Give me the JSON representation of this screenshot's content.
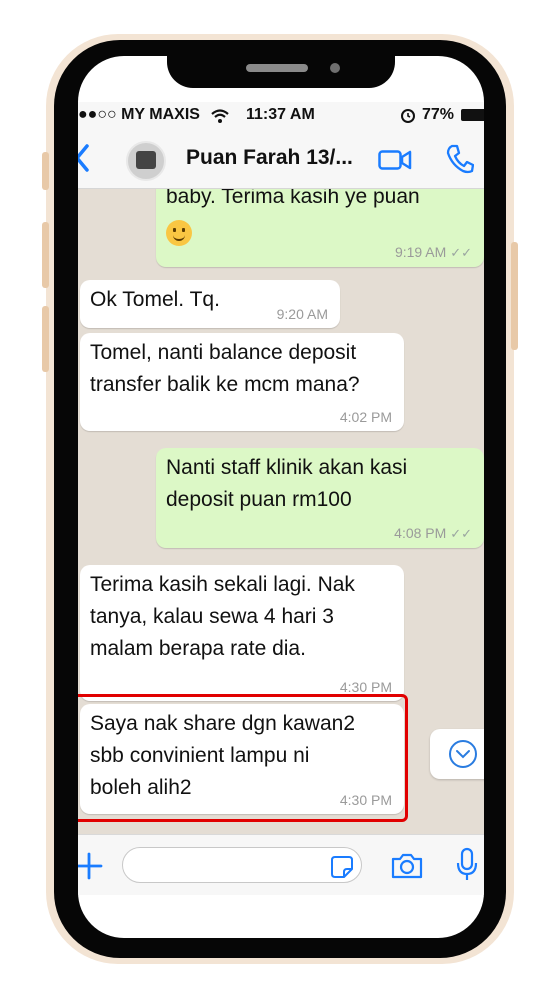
{
  "status_bar": {
    "carrier": "●●○○ MY MAXIS",
    "time": "11:37 AM",
    "battery": "77%"
  },
  "header": {
    "contact_name": "Puan Farah 13/..."
  },
  "messages": [
    {
      "direction": "outgoing",
      "lines": [
        "baby. Terima kasih ye puan"
      ],
      "emoji": "smiling-face",
      "time": "9:19 AM",
      "read": true
    },
    {
      "direction": "incoming",
      "lines": [
        "Ok Tomel. Tq."
      ],
      "time": "9:20 AM"
    },
    {
      "direction": "incoming",
      "lines": [
        "Tomel, nanti balance deposit",
        "transfer balik ke mcm mana?"
      ],
      "time": "4:02 PM"
    },
    {
      "direction": "outgoing",
      "lines": [
        "Nanti staff klinik akan kasi",
        "deposit puan rm100"
      ],
      "time": "4:08 PM",
      "read": true
    },
    {
      "direction": "incoming",
      "lines": [
        "Terima kasih sekali lagi. Nak",
        "tanya, kalau sewa 4 hari 3",
        "malam berapa rate dia."
      ],
      "time": "4:30 PM"
    },
    {
      "direction": "incoming",
      "lines": [
        "Saya nak share dgn kawan2",
        "sbb convinient lampu ni",
        "boleh alih2"
      ],
      "time": "4:30 PM",
      "highlighted": true
    }
  ],
  "ticks_glyph": "✓✓",
  "colors": {
    "outgoing_bubble": "#dcf8c6",
    "incoming_bubble": "#ffffff",
    "chat_background": "#e4ddd4",
    "accent_blue": "#1a7cff",
    "highlight_red": "#e10000"
  },
  "icons": [
    "back-chevron-icon",
    "video-call-icon",
    "phone-call-icon",
    "scroll-down-icon",
    "plus-icon",
    "sticker-icon",
    "camera-icon",
    "microphone-icon",
    "wifi-icon",
    "alarm-icon"
  ]
}
